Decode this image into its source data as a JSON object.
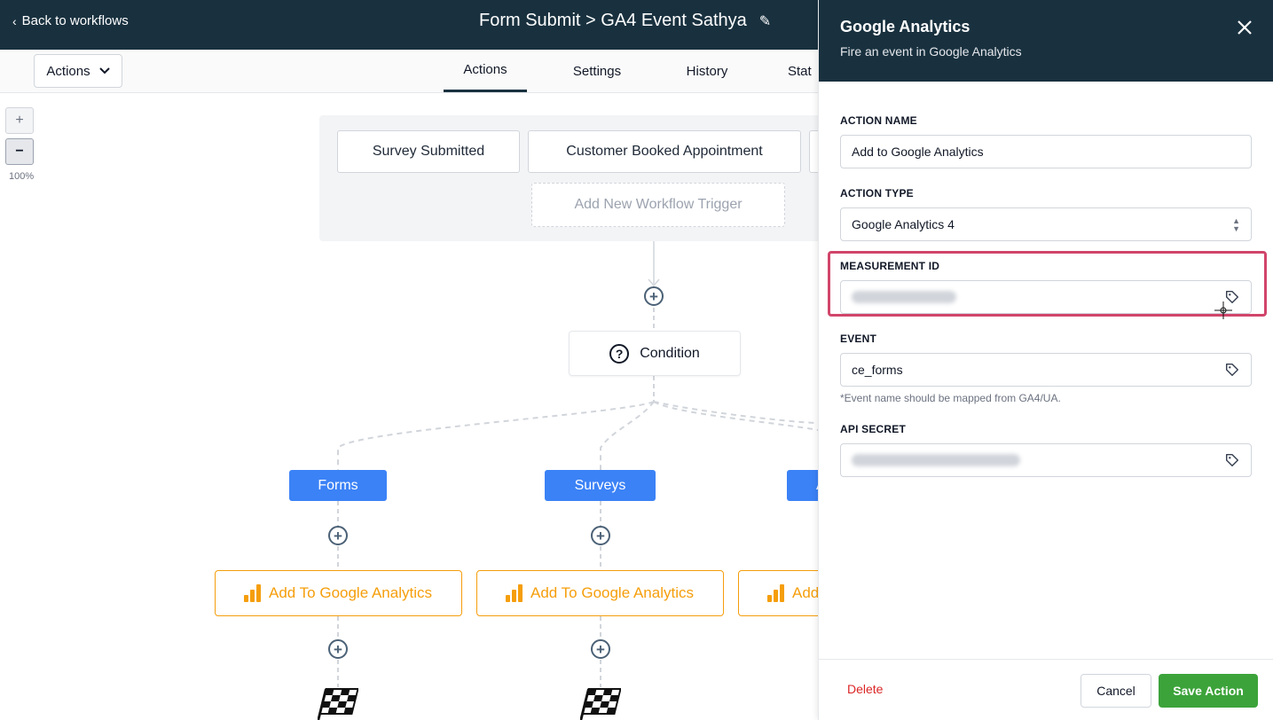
{
  "header": {
    "back_label": "Back to workflows",
    "workflow_title": "Form Submit > GA4 Event Sathya"
  },
  "toolbar": {
    "actions_dropdown": "Actions",
    "tabs": [
      {
        "label": "Actions",
        "active": true
      },
      {
        "label": "Settings",
        "active": false
      },
      {
        "label": "History",
        "active": false
      },
      {
        "label": "Stat",
        "active": false
      }
    ]
  },
  "canvas": {
    "zoom_in": "+",
    "zoom_out": "−",
    "zoom_level": "100%",
    "triggers": [
      "Survey Submitted",
      "Customer Booked Appointment"
    ],
    "add_trigger": "Add New Workflow Trigger",
    "condition_label": "Condition",
    "condition_icon": "?",
    "branches": [
      "Forms",
      "Surveys",
      "A"
    ],
    "action_nodes": [
      "Add To Google Analytics",
      "Add To Google Analytics",
      "Add"
    ]
  },
  "panel": {
    "title": "Google Analytics",
    "subtitle": "Fire an event in Google Analytics",
    "fields": {
      "action_name_label": "ACTION NAME",
      "action_name_value": "Add to Google Analytics",
      "action_type_label": "ACTION TYPE",
      "action_type_value": "Google Analytics 4",
      "measurement_id_label": "MEASUREMENT ID",
      "event_label": "EVENT",
      "event_value": "ce_forms",
      "event_helper": "*Event name should be mapped from GA4/UA.",
      "api_secret_label": "API SECRET"
    },
    "footer": {
      "delete": "Delete",
      "cancel": "Cancel",
      "save": "Save Action"
    }
  },
  "colors": {
    "header_bg": "#19313f",
    "branch_blue": "#3b82f6",
    "action_orange": "#f59e0b",
    "save_green": "#3ca33a",
    "highlight": "#d1456b",
    "delete_red": "#dc2626"
  }
}
